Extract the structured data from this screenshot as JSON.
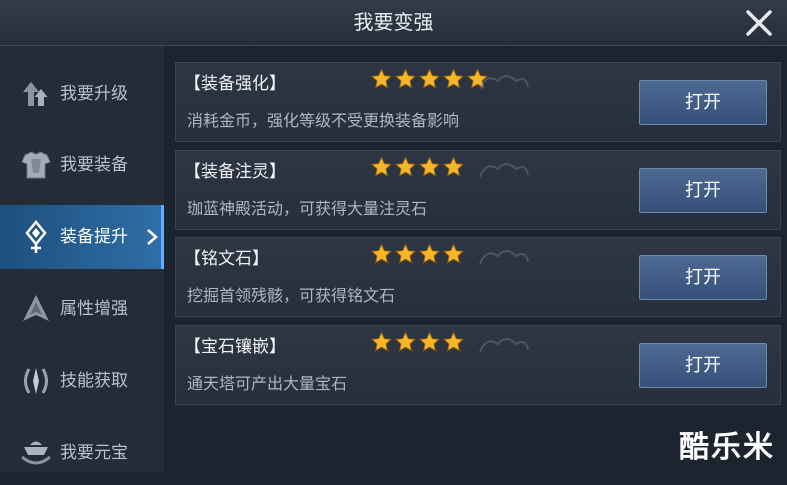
{
  "window": {
    "title": "我要变强",
    "close_icon": "close-icon"
  },
  "sidebar": {
    "items": [
      {
        "label": "我要升级",
        "icon": "level-up-icon",
        "active": false
      },
      {
        "label": "我要装备",
        "icon": "armor-icon",
        "active": false
      },
      {
        "label": "装备提升",
        "icon": "sword-upgrade-icon",
        "active": true
      },
      {
        "label": "属性增强",
        "icon": "attribute-icon",
        "active": false
      },
      {
        "label": "技能获取",
        "icon": "skill-icon",
        "active": false
      },
      {
        "label": "我要元宝",
        "icon": "ingot-icon",
        "active": false
      }
    ]
  },
  "cards": [
    {
      "name": "【装备强化】",
      "stars": 5,
      "desc": "消耗金币，强化等级不受更换装备影响",
      "button": "打开"
    },
    {
      "name": "【装备注灵】",
      "stars": 4,
      "desc": "珈蓝神殿活动，可获得大量注灵石",
      "button": "打开"
    },
    {
      "name": "【铭文石】",
      "stars": 4,
      "desc": "挖掘首领残骸，可获得铭文石",
      "button": "打开"
    },
    {
      "name": "【宝石镶嵌】",
      "stars": 4,
      "desc": "通天塔可产出大量宝石",
      "button": "打开"
    }
  ],
  "watermark": "酷乐米",
  "colors": {
    "accent": "#2f6fa8",
    "star": "#f5b62a",
    "button": "#4d6a92"
  }
}
